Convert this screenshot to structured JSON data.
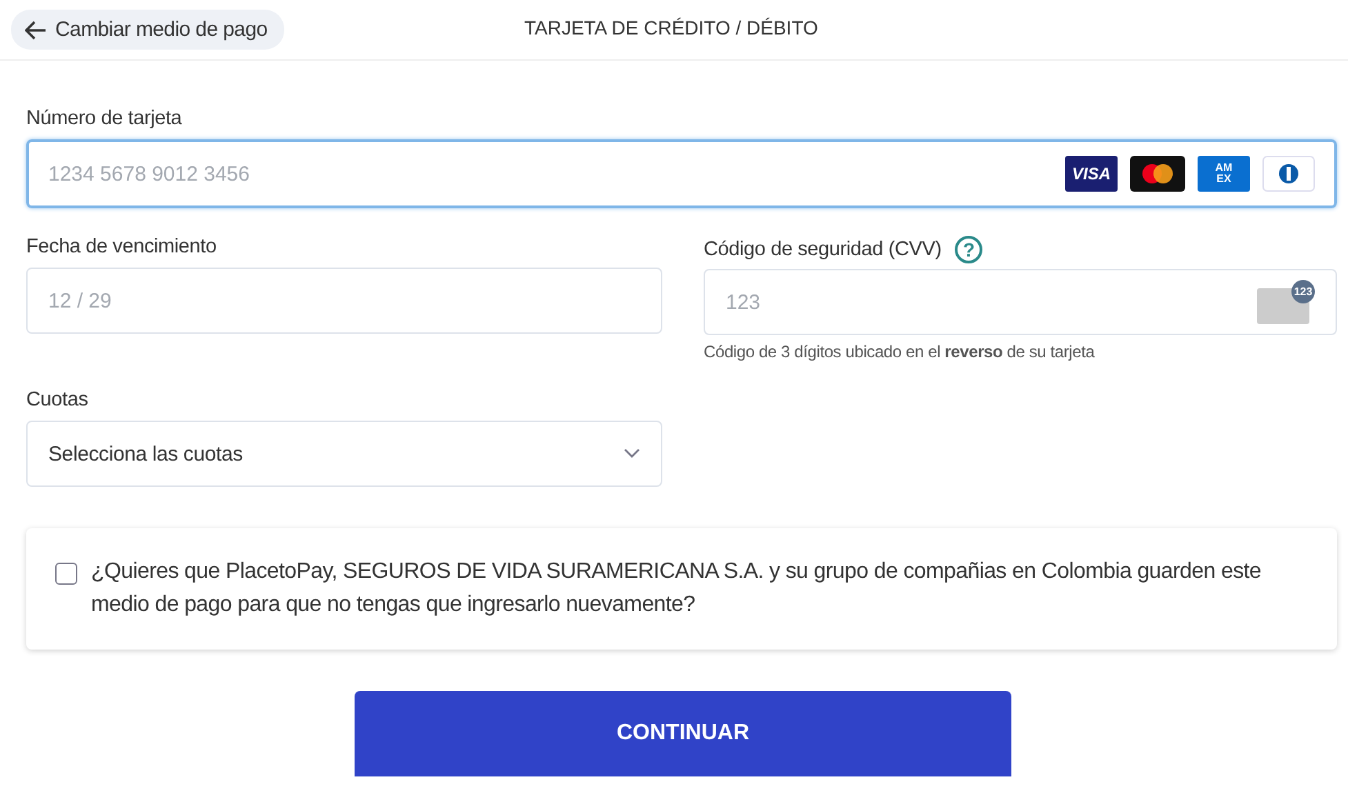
{
  "header": {
    "back_button": "Cambiar medio de pago",
    "title": "TARJETA DE CRÉDITO / DÉBITO"
  },
  "card_number": {
    "label": "Número de tarjeta",
    "placeholder": "1234 5678 9012 3456",
    "focused": true,
    "brands": [
      {
        "kind": "visa",
        "label": "VISA"
      },
      {
        "kind": "mastercard"
      },
      {
        "kind": "amex",
        "label": "AM EX"
      },
      {
        "kind": "diners"
      }
    ]
  },
  "expiry": {
    "label": "Fecha de vencimiento",
    "placeholder": "12 / 29"
  },
  "cvv": {
    "label": "Código de seguridad (CVV)",
    "help": "?",
    "placeholder": "123",
    "card_badge": "123",
    "hint": "Código de 3 dígitos ubicado en el **reverso** de su tarjeta"
  },
  "installments": {
    "label": "Cuotas",
    "value": "Selecciona las cuotas"
  },
  "save_option": {
    "checked": false,
    "text": "¿Quieres que PlacetoPay, SEGUROS DE VIDA SURAMERICANA S.A. y su grupo de compañias en Colombia guarden este medio de pago para que no tengas que ingresarlo nuevamente?"
  },
  "submit_button": "CONTINUAR"
}
